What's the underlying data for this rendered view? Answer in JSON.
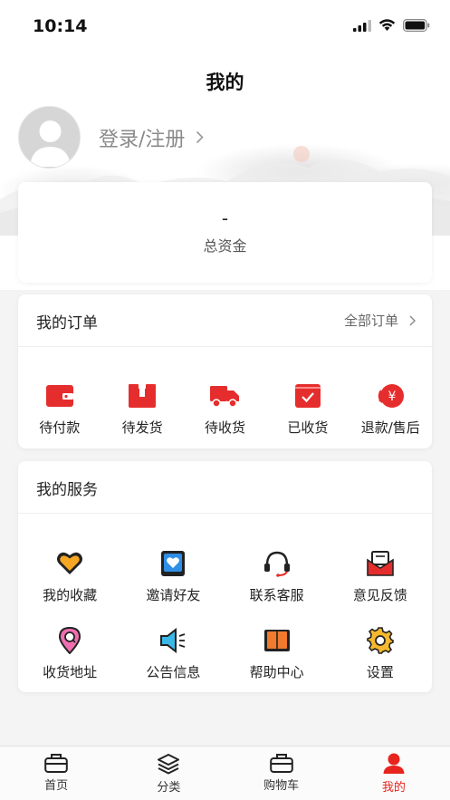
{
  "status_bar": {
    "time": "10:14"
  },
  "header": {
    "title": "我的"
  },
  "profile": {
    "login_label": "登录/注册"
  },
  "funds": {
    "value": "-",
    "label": "总资金"
  },
  "orders": {
    "title": "我的订单",
    "all_label": "全部订单",
    "items": [
      {
        "label": "待付款",
        "icon": "wallet-icon"
      },
      {
        "label": "待发货",
        "icon": "package-icon"
      },
      {
        "label": "待收货",
        "icon": "truck-icon"
      },
      {
        "label": "已收货",
        "icon": "check-box-icon"
      },
      {
        "label": "退款/售后",
        "icon": "refund-icon"
      }
    ]
  },
  "services": {
    "title": "我的服务",
    "items": [
      {
        "label": "我的收藏",
        "icon": "heart-icon"
      },
      {
        "label": "邀请好友",
        "icon": "invite-icon"
      },
      {
        "label": "联系客服",
        "icon": "headset-icon"
      },
      {
        "label": "意见反馈",
        "icon": "feedback-icon"
      },
      {
        "label": "收货地址",
        "icon": "location-pin-icon"
      },
      {
        "label": "公告信息",
        "icon": "announcement-icon"
      },
      {
        "label": "帮助中心",
        "icon": "book-icon"
      },
      {
        "label": "设置",
        "icon": "gear-icon"
      }
    ]
  },
  "tabbar": {
    "items": [
      {
        "label": "首页",
        "icon": "briefcase-icon"
      },
      {
        "label": "分类",
        "icon": "layers-icon"
      },
      {
        "label": "购物车",
        "icon": "briefcase-icon"
      },
      {
        "label": "我的",
        "icon": "person-icon",
        "active": true
      }
    ]
  },
  "colors": {
    "accent": "#e8241e",
    "icon_red": "#e62d2d",
    "icon_orange": "#f5a623",
    "icon_blue": "#2f8fe6"
  }
}
